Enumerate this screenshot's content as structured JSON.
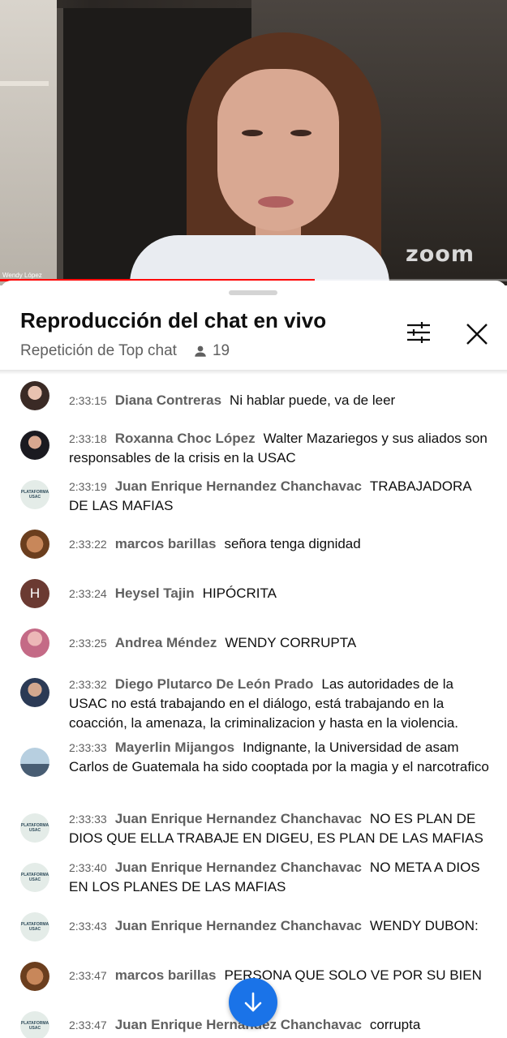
{
  "video": {
    "speaker_name": "Wendy López",
    "watermark": "zoom",
    "progress_percent": 62
  },
  "chat_panel": {
    "title": "Reproducción del chat en vivo",
    "subtitle": "Repetición de Top chat",
    "viewer_count": "19",
    "icons": {
      "viewers": "person-icon",
      "filter": "tune-icon",
      "close": "close-icon",
      "scroll": "arrow-down-icon"
    },
    "accent_color": "#1a73e8",
    "progress_color": "#ff0000"
  },
  "messages": [
    {
      "time": "2:33:15",
      "author": "Diana Contreras",
      "text": "Ni hablar puede, va de leer",
      "avatar": "photo"
    },
    {
      "time": "2:33:18",
      "author": "Roxanna Choc López",
      "text": "Walter Mazariegos y sus aliados son responsables de la crisis en la USAC",
      "avatar": "photo"
    },
    {
      "time": "2:33:19",
      "author": "Juan Enrique Hernandez Chanchavac",
      "text": "TRABAJADORA DE LAS MAFIAS",
      "avatar": "logo"
    },
    {
      "time": "2:33:22",
      "author": "marcos barillas",
      "text": "señora tenga dignidad",
      "avatar": "photo"
    },
    {
      "time": "2:33:24",
      "author": "Heysel Tajin",
      "text": "HIPÓCRITA",
      "avatar": "H"
    },
    {
      "time": "2:33:25",
      "author": "Andrea Méndez",
      "text": "WENDY CORRUPTA",
      "avatar": "photo"
    },
    {
      "time": "2:33:32",
      "author": "Diego Plutarco De León Prado",
      "text": "Las autoridades de la USAC no está trabajando en el diálogo, está trabajando en la coacción, la amenaza, la criminalizacion y hasta en la violencia.",
      "avatar": "photo"
    },
    {
      "time": "2:33:33",
      "author": "Mayerlin Mijangos",
      "text": "Indignante, la Universidad de asam Carlos de Guatemala ha sido cooptada por la magia y el narcotrafico",
      "avatar": "photo"
    },
    {
      "time": "2:33:33",
      "author": "Juan Enrique Hernandez Chanchavac",
      "text": "NO ES PLAN DE DIOS QUE ELLA TRABAJE EN DIGEU, ES PLAN DE LAS MAFIAS",
      "avatar": "logo"
    },
    {
      "time": "2:33:40",
      "author": "Juan Enrique Hernandez Chanchavac",
      "text": "NO META A DIOS EN LOS PLANES DE LAS MAFIAS",
      "avatar": "logo"
    },
    {
      "time": "2:33:43",
      "author": "Juan Enrique Hernandez Chanchavac",
      "text": "WENDY DUBON:",
      "avatar": "logo"
    },
    {
      "time": "2:33:47",
      "author": "marcos barillas",
      "text": "PERSONA QUE SOLO VE POR SU BIEN",
      "avatar": "photo"
    },
    {
      "time": "2:33:47",
      "author": "Juan Enrique Hernandez Chanchavac",
      "text": "corrupta",
      "avatar": "logo"
    }
  ]
}
